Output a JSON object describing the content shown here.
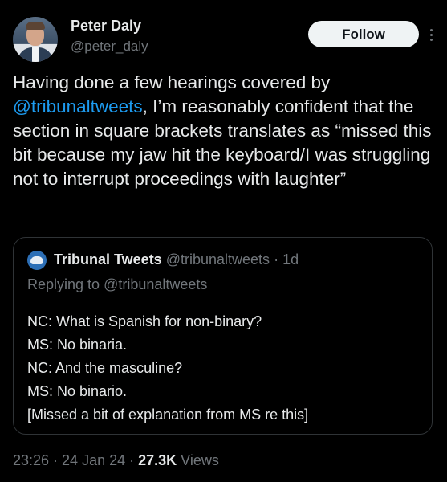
{
  "author": {
    "name": "Peter Daly",
    "handle": "@peter_daly",
    "follow_label": "Follow"
  },
  "tweet": {
    "text_pre": "Having done a few hearings covered by ",
    "mention": "@tribunaltweets",
    "text_post": ", I’m reasonably confident that the section in square brackets translates as “missed this bit because my jaw hit the keyboard/I was struggling not to interrupt proceedings with laughter”"
  },
  "quote": {
    "name": "Tribunal Tweets",
    "handle": "@tribunaltweets",
    "separator": " · ",
    "age": "1d",
    "replying_prefix": "Replying to ",
    "replying_handle": "@tribunaltweets",
    "lines": [
      "NC: What is Spanish for non-binary?",
      "MS: No binaria.",
      "NC: And the masculine?",
      "MS: No binario.",
      "[Missed a bit of explanation from MS re this]"
    ]
  },
  "footer": {
    "time": "23:26",
    "sep1": " · ",
    "date": "24 Jan 24",
    "sep2": " · ",
    "views_count": "27.3K",
    "views_label": " Views"
  },
  "icons": {
    "avatar": "profile-photo",
    "more": "more-options-icon",
    "quote_avatar": "tribunal-tweets-avatar"
  }
}
